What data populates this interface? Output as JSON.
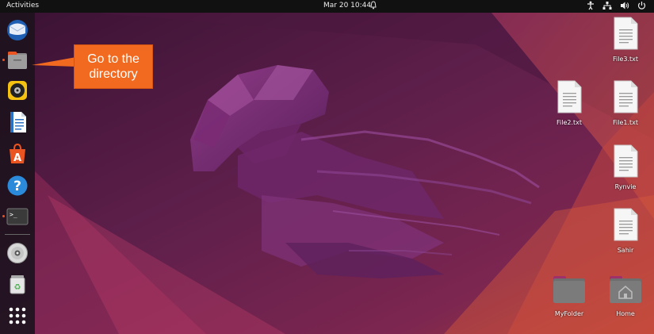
{
  "topbar": {
    "activities": "Activities",
    "clock": "Mar 20  10:44"
  },
  "dock": {
    "items": [
      {
        "icon": "thunderbird-icon"
      },
      {
        "icon": "files-icon"
      },
      {
        "icon": "rhythmbox-icon"
      },
      {
        "icon": "writer-icon"
      },
      {
        "icon": "software-icon"
      },
      {
        "icon": "help-icon"
      },
      {
        "icon": "terminal-icon"
      },
      {
        "icon": "disc-icon"
      },
      {
        "icon": "trash-icon"
      },
      {
        "icon": "app-grid-icon"
      }
    ]
  },
  "callout": {
    "text": "Go to the directory",
    "color": "#f26a1f"
  },
  "desktop": {
    "icons": [
      {
        "label": "File3.txt"
      },
      {
        "label": "File2.txt"
      },
      {
        "label": "File1.txt"
      },
      {
        "label": "Rynvie"
      },
      {
        "label": "Sahir"
      },
      {
        "label": "MyFolder"
      },
      {
        "label": "Home"
      }
    ]
  },
  "colors": {
    "accent": "#e95420",
    "wallpaper": "#5c1f49"
  }
}
